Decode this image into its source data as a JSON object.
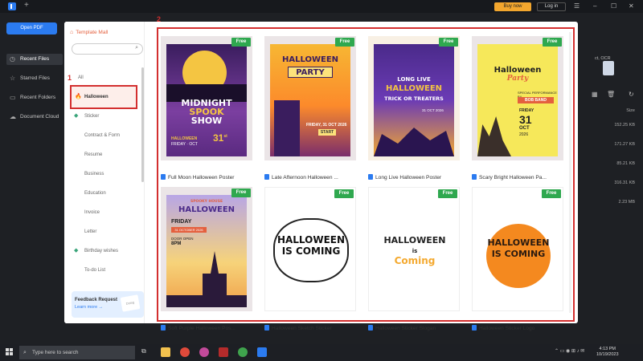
{
  "titlebar": {
    "new_tab": "+",
    "buy_label": "Buy now",
    "login_label": "Log in"
  },
  "sidebar": {
    "open_pdf": "Open PDF",
    "items": [
      {
        "label": "Recent Files",
        "icon": "clock-icon"
      },
      {
        "label": "Starred Files",
        "icon": "star-icon"
      },
      {
        "label": "Recent Folders",
        "icon": "folder-icon"
      },
      {
        "label": "Document Cloud",
        "icon": "cloud-icon"
      }
    ]
  },
  "background": {
    "ocr_text": "ct, OCR",
    "sizes": [
      "Size",
      "152.25 KB",
      "171.27 KB",
      "85.21 KB",
      "316.31 KB",
      "2.23 MB"
    ]
  },
  "modal": {
    "title": "Template Mall",
    "search_placeholder": "",
    "categories": [
      "All",
      "Halloween",
      "Sticker",
      "Contract & Form",
      "Resume",
      "Business",
      "Education",
      "Invoice",
      "Letter",
      "Birthday wishes",
      "To-do List"
    ],
    "feedback": {
      "title": "Feedback Request",
      "link": "Learn more →",
      "card": "Doing"
    },
    "annotations": {
      "one": "1",
      "two": "2"
    },
    "badge": "Free",
    "templates": [
      {
        "label": "Full Moon Halloween Poster",
        "line1": "MIDNIGHT",
        "line2": "SPOOK",
        "line3": "SHOW",
        "sub": "HALLOWEEN",
        "sub2": "FRIDAY · OCT",
        "num": "31",
        "numsup": "st"
      },
      {
        "label": "Late Afternoon Halloween ...",
        "line1": "HALLOWEEN",
        "line2": "PARTY",
        "sub": "FRIDAY, 31 OCT 2026",
        "btn": "START"
      },
      {
        "label": "Long Live Halloween Poster",
        "line1": "LONG LIVE",
        "line2": "HALLOWEEN",
        "line3": "TRICK",
        "or": "OR",
        "line4": "TREATERS",
        "sub": "31 OCT 2026"
      },
      {
        "label": "Scary Bright Halloween Pa...",
        "line1": "Halloween",
        "line2": "Party",
        "sub1": "SPECIAL PERFORMANCE BY",
        "band": "BOB BAND",
        "sub2": "FRIDAY",
        "num": "31",
        "mon": "OCT",
        "year": "2026"
      },
      {
        "label": "Soft Purple Halloween Pos...",
        "top": "SPOOKY HOUSE",
        "line1": "HALLOWEEN",
        "line2": "FRIDAY",
        "sub": "31 OCTOBER 2026",
        "doors": "DOOR OPEN",
        "time": "8PM"
      },
      {
        "label": "Halloween Sketch Sticker",
        "line1": "HALLOWEEN",
        "line2": "IS COMING"
      },
      {
        "label": "Halloween Sticker Slogan",
        "line1": "HALLOWEEN",
        "line2": "is",
        "line3": "Coming"
      },
      {
        "label": "Halloween Sticker Logo",
        "line1": "HALLOWEEN",
        "line2": "IS COMING"
      }
    ]
  },
  "taskbar": {
    "search_placeholder": "Type here to search",
    "time": "4:13 PM",
    "date": "10/19/2023"
  },
  "colors": {
    "accent": "#2b7bf0",
    "free_badge": "#2fa84f",
    "annotation": "#d32f2f",
    "template_mall": "#e4603e",
    "buy": "#f2a62e"
  }
}
